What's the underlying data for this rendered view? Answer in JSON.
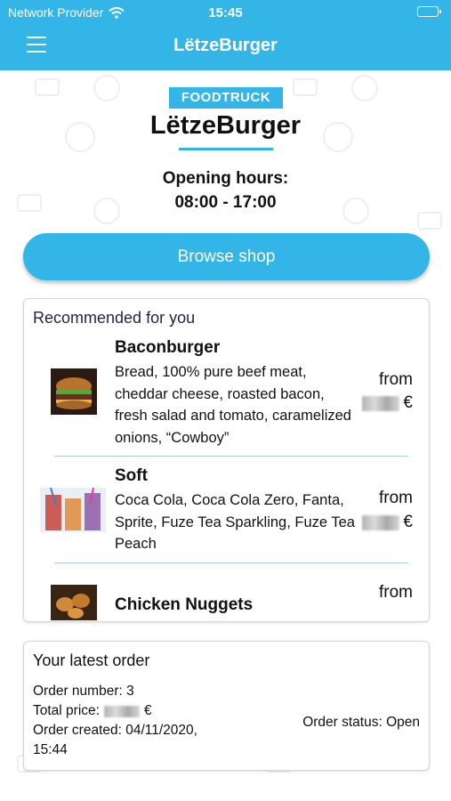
{
  "status_bar": {
    "provider": "Network Provider",
    "time": "15:45"
  },
  "header": {
    "title": "LëtzeBurger"
  },
  "brand": {
    "badge": "FOODTRUCK",
    "name": "LëtzeBurger"
  },
  "hours": {
    "label": "Opening hours:",
    "value": "08:00 - 17:00"
  },
  "browse_button": "Browse shop",
  "recommended": {
    "heading": "Recommended for you",
    "from_label": "from",
    "currency": "€",
    "items": [
      {
        "name": "Baconburger",
        "description": "Bread, 100% pure beef meat, cheddar cheese, roasted bacon, fresh salad and tomato, caramelized onions, “Cowboy”"
      },
      {
        "name": "Soft",
        "description": "Coca Cola, Coca Cola Zero, Fanta, Sprite, Fuze Tea Sparkling, Fuze Tea Peach"
      },
      {
        "name": "Chicken Nuggets",
        "description": ""
      }
    ]
  },
  "latest_order": {
    "heading": "Your latest order",
    "order_number": "Order number: 3",
    "total_price_label": "Total price:",
    "currency": "€",
    "created_line1": "Order created: 04/11/2020,",
    "created_line2": "15:44",
    "status": "Order status: Open"
  },
  "colors": {
    "accent": "#33b5e8"
  }
}
